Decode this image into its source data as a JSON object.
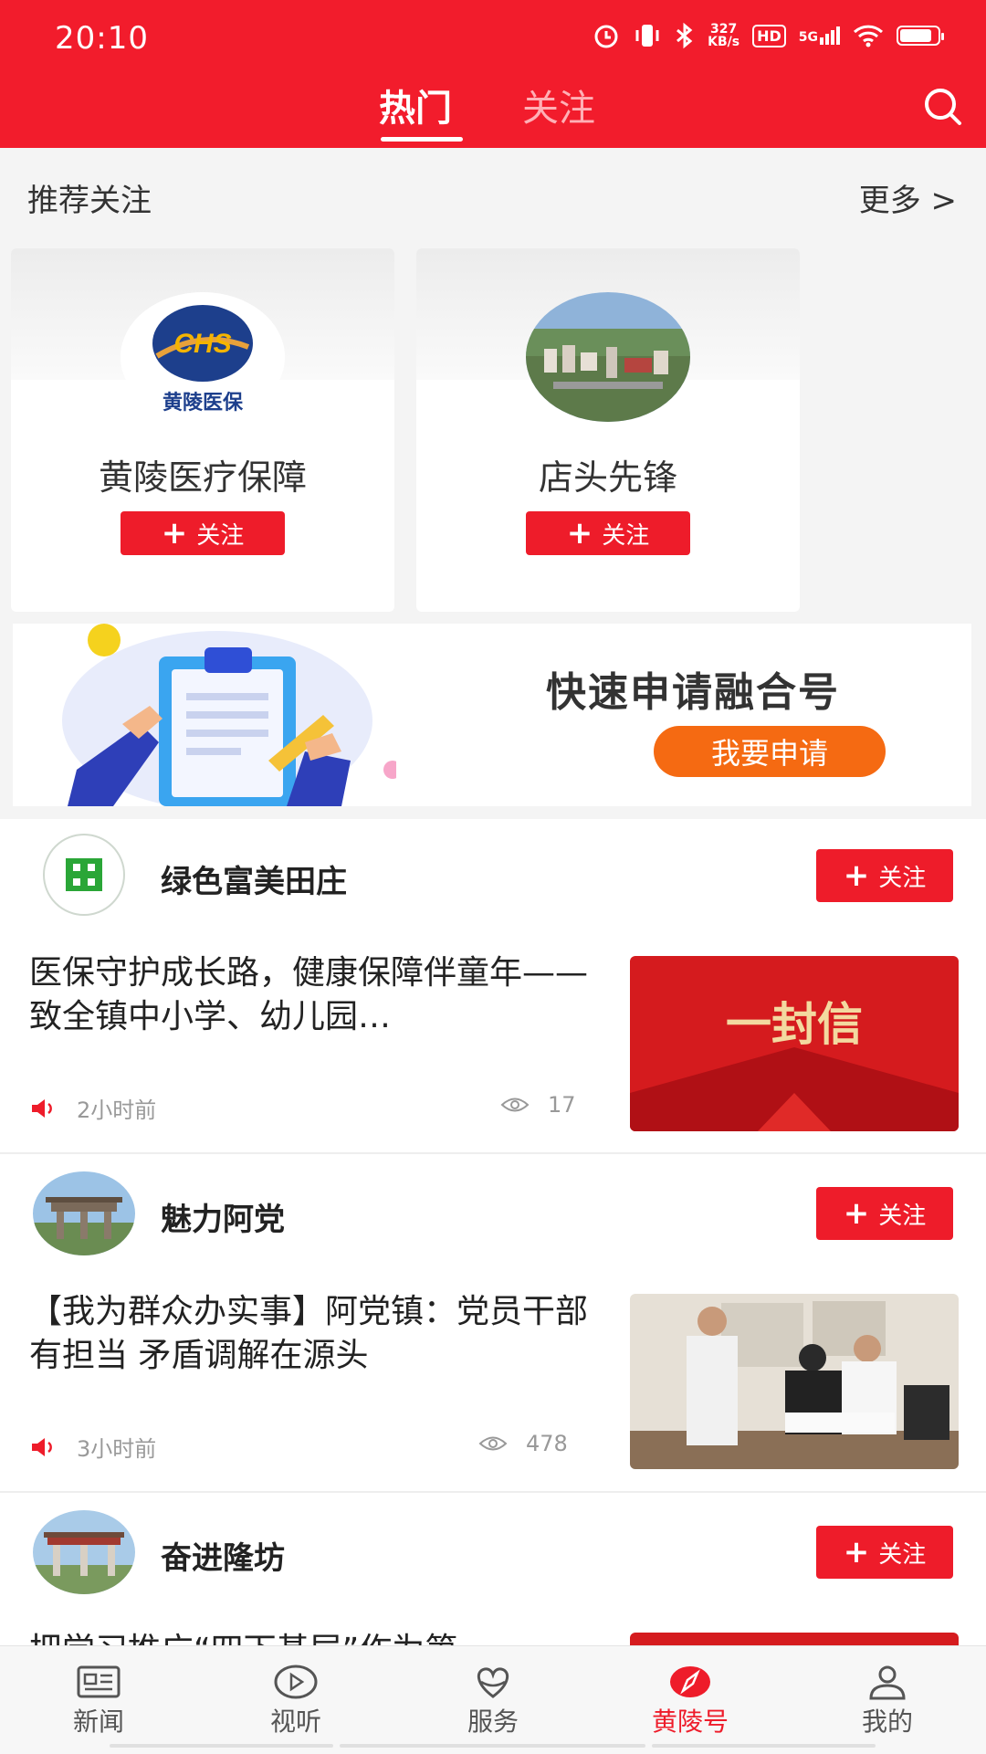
{
  "status_bar": {
    "time": "20:10",
    "net_speed_value": "327",
    "net_speed_unit": "KB/s",
    "hd": "HD",
    "net_type": "5G"
  },
  "header": {
    "tabs": [
      {
        "label": "热门",
        "active": true
      },
      {
        "label": "关注",
        "active": false
      }
    ],
    "accent_color": "#f21c2c"
  },
  "recommend": {
    "title": "推荐关注",
    "more": "更多 >",
    "cards": [
      {
        "name": "黄陵医疗保障",
        "follow_label": "关注",
        "logo_text": "CHS",
        "logo_caption": "黄陵医保"
      },
      {
        "name": "店头先锋",
        "follow_label": "关注"
      }
    ]
  },
  "banner": {
    "title": "快速申请融合号",
    "button": "我要申请"
  },
  "feed": [
    {
      "author": "绿色富美田庄",
      "follow_label": "关注",
      "title": "医保守护成长路，健康保障伴童年——致全镇中小学、幼儿园…",
      "thumb_text": "一封信",
      "time": "2小时前",
      "views": "17"
    },
    {
      "author": "魅力阿党",
      "follow_label": "关注",
      "title": "【我为群众办实事】阿党镇：党员干部有担当 矛盾调解在源头",
      "time": "3小时前",
      "views": "478"
    },
    {
      "author": "奋进隆坊",
      "follow_label": "关注",
      "title": "把学习推广“四下基层”作为第"
    }
  ],
  "bottom_nav": [
    {
      "label": "新闻",
      "icon": "news-icon",
      "active": false
    },
    {
      "label": "视听",
      "icon": "play-icon",
      "active": false
    },
    {
      "label": "服务",
      "icon": "service-heart-icon",
      "active": false
    },
    {
      "label": "黄陵号",
      "icon": "compass-icon",
      "active": true
    },
    {
      "label": "我的",
      "icon": "user-icon",
      "active": false
    }
  ]
}
